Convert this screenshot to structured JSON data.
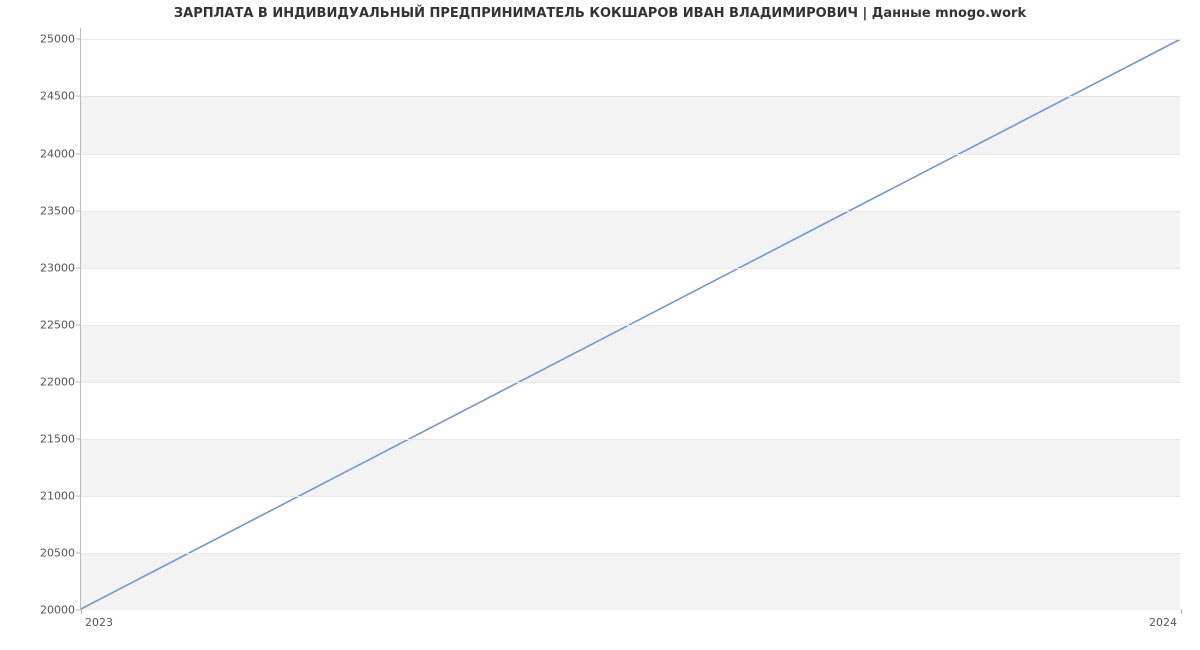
{
  "chart_data": {
    "type": "line",
    "title": "ЗАРПЛАТА В ИНДИВИДУАЛЬНЫЙ ПРЕДПРИНИМАТЕЛЬ КОКШАРОВ ИВАН ВЛАДИМИРОВИЧ | Данные mnogo.work",
    "x": [
      2023,
      2024
    ],
    "y": [
      20000,
      25000
    ],
    "xlabel": "",
    "ylabel": "",
    "xticks": [
      2023,
      2024
    ],
    "yticks": [
      20000,
      20500,
      21000,
      21500,
      22000,
      22500,
      23000,
      23500,
      24000,
      24500,
      25000
    ],
    "ylim": [
      20000,
      25100
    ],
    "xlim": [
      2023,
      2024
    ],
    "line_color": "#6f97d4"
  }
}
